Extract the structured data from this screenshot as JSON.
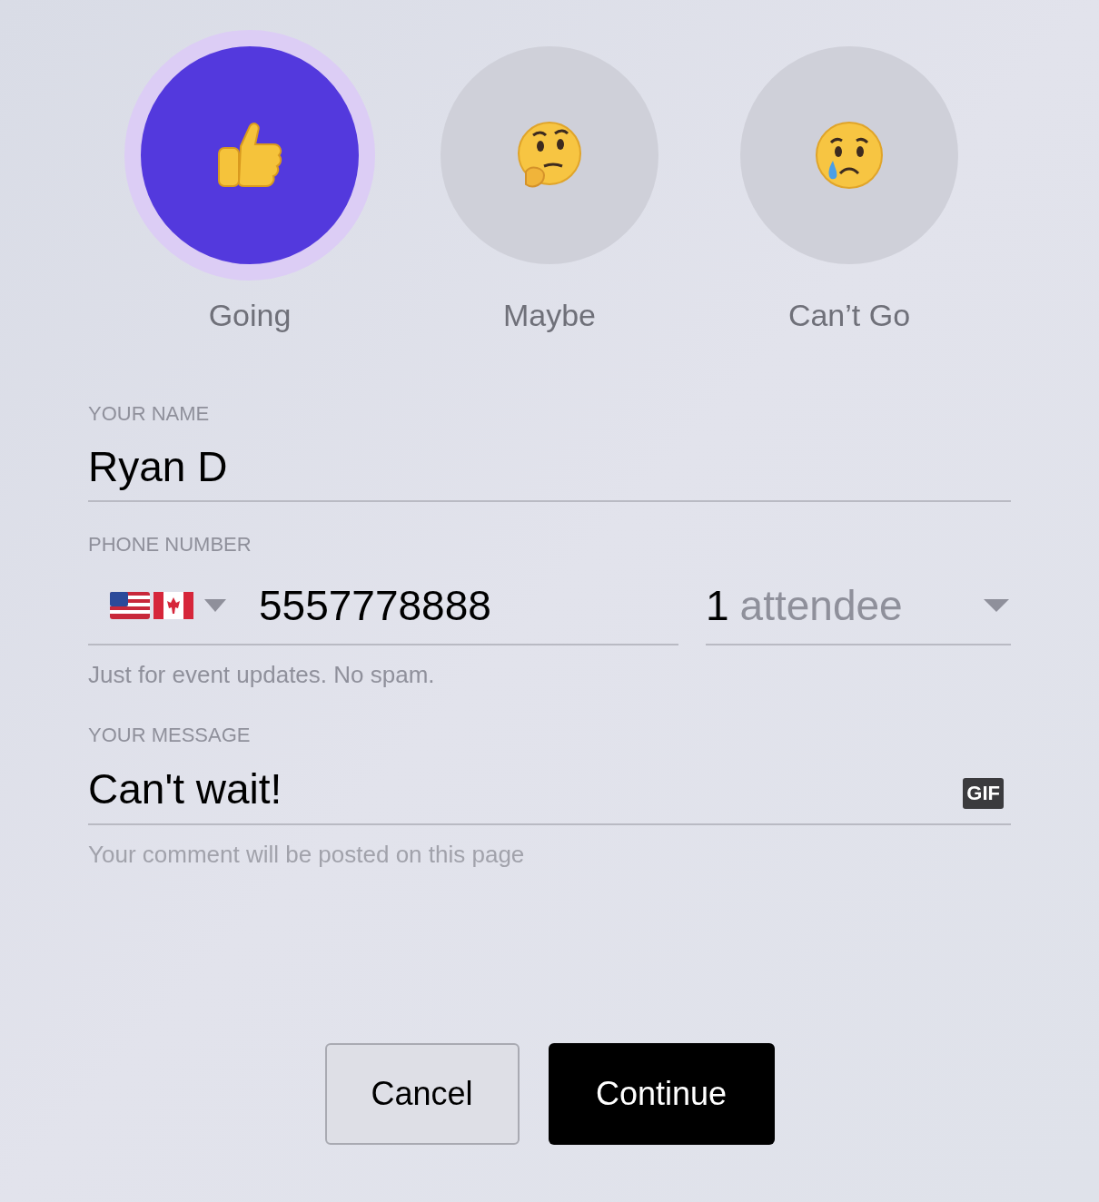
{
  "rsvp_options": [
    {
      "label": "Going",
      "kind": "thumbs_up",
      "selected": true
    },
    {
      "label": "Maybe",
      "kind": "thinking",
      "selected": false
    },
    {
      "label": "Can’t Go",
      "kind": "crying",
      "selected": false
    }
  ],
  "name_field": {
    "label": "YOUR NAME",
    "value": "Ryan D"
  },
  "phone_field": {
    "label": "PHONE NUMBER",
    "value": "5557778888",
    "hint": "Just for event updates. No spam."
  },
  "attendees": {
    "count": "1",
    "unit": "attendee"
  },
  "message_field": {
    "label": "YOUR MESSAGE",
    "value": "Can't wait!",
    "gif_button": "GIF",
    "hint": "Your comment will be posted on this page"
  },
  "buttons": [
    {
      "label": "Cancel",
      "kind": "secondary"
    },
    {
      "label": "Continue",
      "kind": "primary"
    }
  ]
}
